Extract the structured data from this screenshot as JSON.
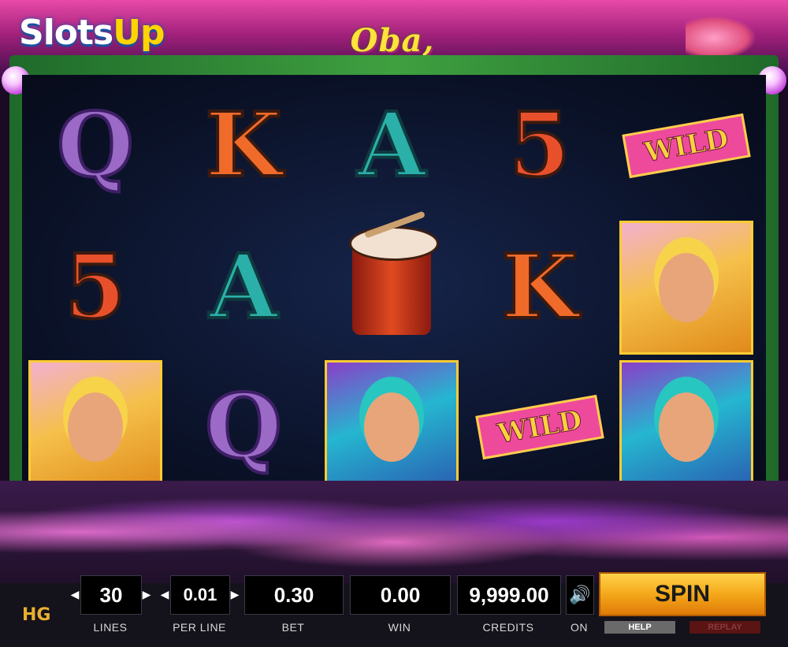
{
  "branding": {
    "logo_slots": "Slots",
    "logo_up": "Up",
    "game_title": "Oba, CARNAVAL!",
    "provider_logo": "HG"
  },
  "reels": [
    [
      {
        "symbol": "Q",
        "type": "letter"
      },
      {
        "symbol": "5",
        "type": "letter"
      },
      {
        "symbol": "dancer",
        "type": "portrait"
      }
    ],
    [
      {
        "symbol": "K",
        "type": "letter"
      },
      {
        "symbol": "A",
        "type": "letter"
      },
      {
        "symbol": "Q",
        "type": "letter"
      }
    ],
    [
      {
        "symbol": "A",
        "type": "letter"
      },
      {
        "symbol": "drum",
        "type": "drum"
      },
      {
        "symbol": "drummers",
        "type": "portrait"
      }
    ],
    [
      {
        "symbol": "5",
        "type": "letter"
      },
      {
        "symbol": "K",
        "type": "letter"
      },
      {
        "symbol": "WILD",
        "type": "wild"
      }
    ],
    [
      {
        "symbol": "WILD",
        "type": "wild"
      },
      {
        "symbol": "dancer",
        "type": "portrait"
      },
      {
        "symbol": "drummers",
        "type": "portrait"
      }
    ]
  ],
  "controls": {
    "lines": {
      "value": "30",
      "label": "LINES"
    },
    "per_line": {
      "value": "0.01",
      "label": "PER LINE"
    },
    "bet": {
      "value": "0.30",
      "label": "BET"
    },
    "win": {
      "value": "0.00",
      "label": "WIN"
    },
    "credits": {
      "value": "9,999.00",
      "label": "CREDITS"
    },
    "sound": {
      "label": "ON",
      "icon": "speaker-icon"
    },
    "spin_label": "SPIN",
    "help_label": "HELP",
    "replay_label": "REPLAY",
    "arrow_left": "◀",
    "arrow_right": "▶"
  },
  "colors": {
    "spin_button": "#f4a81a",
    "frame_vine": "#3fa040",
    "reel_background": "#0a1126"
  }
}
